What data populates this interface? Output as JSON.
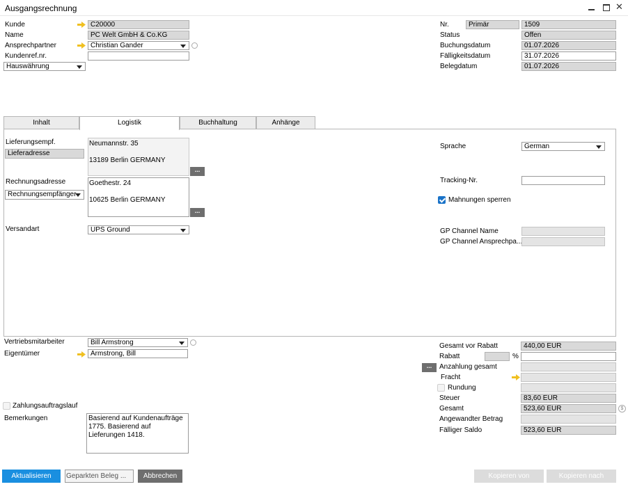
{
  "window": {
    "title": "Ausgangsrechnung",
    "controls": [
      "minimize-icon",
      "maximize-icon",
      "close-icon"
    ]
  },
  "header_left": {
    "kunde_label": "Kunde",
    "kunde_value": "C20000",
    "name_label": "Name",
    "name_value": "PC Welt GmbH & Co.KG",
    "ansprech_label": "Ansprechpartner",
    "ansprech_value": "Christian Gander",
    "kundenref_label": "Kundenref.nr.",
    "kundenref_value": "",
    "waehrung_value": "Hauswährung"
  },
  "header_right": {
    "nr_label": "Nr.",
    "nr_series": "Primär",
    "nr_value": "1509",
    "status_label": "Status",
    "status_value": "Offen",
    "buchungsdatum_label": "Buchungsdatum",
    "buchungsdatum_value": "01.07.2026",
    "faelligkeit_label": "Fälligkeitsdatum",
    "faelligkeit_value": "31.07.2026",
    "belegdatum_label": "Belegdatum",
    "belegdatum_value": "01.07.2026"
  },
  "tabs": [
    {
      "label": "Inhalt",
      "active": false
    },
    {
      "label": "Logistik",
      "active": true
    },
    {
      "label": "Buchhaltung",
      "active": false
    },
    {
      "label": "Anhänge",
      "active": false
    }
  ],
  "logistik": {
    "lieferempf_label": "Lieferungsempf.",
    "lieferadresse_value": "Lieferadresse",
    "liefer_address": "Neumannstr. 35\n\n13189 Berlin GERMANY",
    "rechnungsadresse_label": "Rechnungsadresse",
    "rechnungsempf_value": "Rechnungsempfänger",
    "rechnung_address": "Goethestr. 24\n\n10625 Berlin GERMANY",
    "versandart_label": "Versandart",
    "versandart_value": "UPS Ground",
    "sprache_label": "Sprache",
    "sprache_value": "German",
    "tracking_label": "Tracking-Nr.",
    "tracking_value": "",
    "mahnungen_label": "Mahnungen sperren",
    "mahnungen_checked": true,
    "gp_channel_name_label": "GP Channel Name",
    "gp_channel_ansprech_label": "GP Channel Ansprechpa...",
    "dots_label": "..."
  },
  "footer_left": {
    "vertrieb_label": "Vertriebsmitarbeiter",
    "vertrieb_value": "Bill Armstrong",
    "eigentuemer_label": "Eigentümer",
    "eigentuemer_value": "Armstrong, Bill",
    "zahlungsauftrag_label": "Zahlungsauftragslauf",
    "bemerkungen_label": "Bemerkungen",
    "bemerkungen_value": "Basierend auf Kundenaufträge 1775. Basierend auf Lieferungen 1418."
  },
  "totals": {
    "gesamt_vor_rabatt_label": "Gesamt vor Rabatt",
    "gesamt_vor_rabatt_value": "440,00 EUR",
    "rabatt_label": "Rabatt",
    "rabatt_percent_sign": "%",
    "rabatt_value": "",
    "anzahlung_label": "Anzahlung gesamt",
    "anzahlung_value": "",
    "fracht_label": "Fracht",
    "fracht_value": "",
    "rundung_label": "Rundung",
    "rundung_value": "",
    "steuer_label": "Steuer",
    "steuer_value": "83,60 EUR",
    "gesamt_label": "Gesamt",
    "gesamt_value": "523,60 EUR",
    "angewandt_label": "Angewandter Betrag",
    "angewandt_value": "",
    "faelliger_saldo_label": "Fälliger Saldo",
    "faelliger_saldo_value": "523,60 EUR"
  },
  "buttons": {
    "aktualisieren": "Aktualisieren",
    "geparkten": "Geparkten Beleg ...",
    "abbrechen": "Abbrechen",
    "kopieren_von": "Kopieren von",
    "kopieren_nach": "Kopieren nach"
  },
  "colors": {
    "primary_button": "#1a8fe0",
    "link_arrow": "#f0c020",
    "dark_button": "#6e6e6e",
    "disabled_button": "#dcdcdc"
  }
}
